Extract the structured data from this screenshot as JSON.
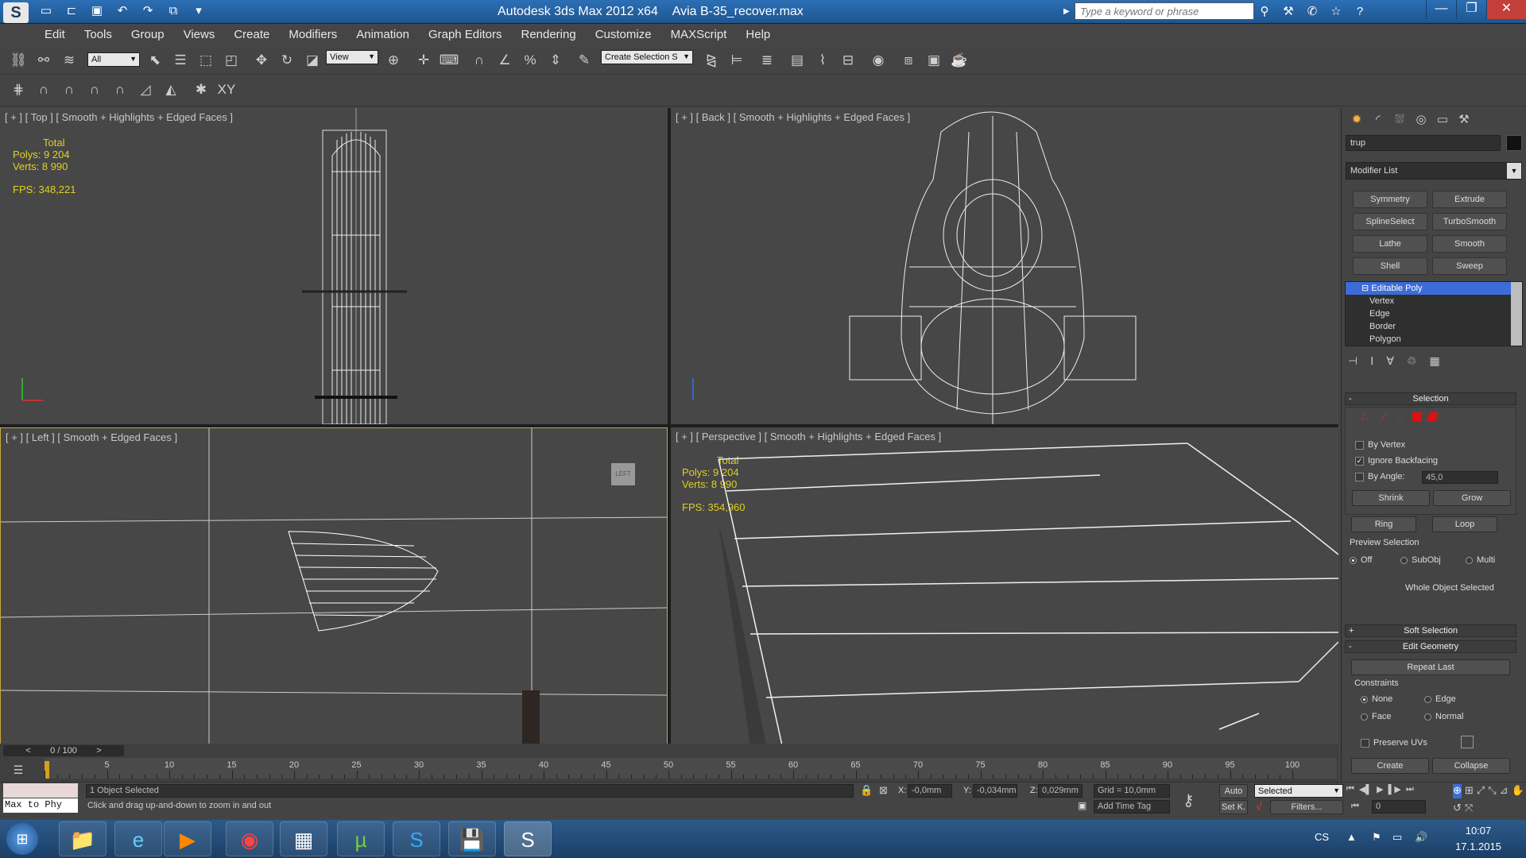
{
  "titlebar": {
    "app": "Autodesk 3ds Max  2012 x64",
    "file": "Avia B-35_recover.max",
    "search_placeholder": "Type a keyword or phrase",
    "logo": "S"
  },
  "menu": [
    "Edit",
    "Tools",
    "Group",
    "Views",
    "Create",
    "Modifiers",
    "Animation",
    "Graph Editors",
    "Rendering",
    "Customize",
    "MAXScript",
    "Help"
  ],
  "toolbar": {
    "filter_value": "All",
    "refcoord_value": "View",
    "selset_value": "Create Selection S"
  },
  "viewports": {
    "top": {
      "label": "[ + ] [ Top ] [ Smooth + Highlights + Edged Faces ]",
      "stats_total": "Total",
      "polys": "Polys: 9 204",
      "verts": "Verts: 8 990",
      "fps": "FPS:   348,221"
    },
    "back": {
      "label": "[ + ] [ Back ] [ Smooth + Highlights + Edged Faces ]"
    },
    "left": {
      "label": "[ + ] [ Left ] [ Smooth + Edged Faces ]",
      "viewcube": "LEFT"
    },
    "persp": {
      "label": "[ + ] [ Perspective ] [ Smooth + Highlights + Edged Faces ]",
      "stats_total": "Total",
      "polys": "Polys: 9 204",
      "verts": "Verts: 8 990",
      "fps": "FPS:   354,960"
    }
  },
  "command_panel": {
    "object_name": "trup",
    "object_color": "#111111",
    "modifier_list": "Modifier List",
    "modifier_buttons": [
      "Symmetry",
      "Extrude",
      "SplineSelect",
      "TurboSmooth",
      "Lathe",
      "Smooth",
      "Shell",
      "Sweep"
    ],
    "stack": [
      "Editable Poly",
      "Vertex",
      "Edge",
      "Border",
      "Polygon"
    ],
    "selection": {
      "title": "Selection",
      "by_vertex": "By Vertex",
      "ignore_backfacing": "Ignore Backfacing",
      "by_angle": "By Angle:",
      "angle_value": "45,0",
      "shrink": "Shrink",
      "grow": "Grow",
      "ring": "Ring",
      "loop": "Loop",
      "preview_title": "Preview Selection",
      "off": "Off",
      "subobj": "SubObj",
      "multi": "Multi",
      "status": "Whole Object Selected"
    },
    "soft_selection": "Soft Selection",
    "edit_geometry": {
      "title": "Edit Geometry",
      "repeat_last": "Repeat Last",
      "constraints": "Constraints",
      "none": "None",
      "edge": "Edge",
      "face": "Face",
      "normal": "Normal",
      "preserve_uvs": "Preserve UVs",
      "create": "Create",
      "collapse": "Collapse"
    }
  },
  "timeline": {
    "frame_display": "0 / 100",
    "tick_labels": [
      "5",
      "10",
      "15",
      "20",
      "25",
      "30",
      "35",
      "40",
      "45",
      "50",
      "55",
      "60",
      "65",
      "70",
      "75",
      "80",
      "85",
      "90",
      "95",
      "100"
    ]
  },
  "status": {
    "maxscript": "Max to Phy",
    "objects_selected": "1 Object Selected",
    "prompt": "Click and drag up-and-down to zoom in and out",
    "x_label": "X:",
    "x": "-0,0mm",
    "y_label": "Y:",
    "y": "-0,034mm",
    "z_label": "Z:",
    "z": "0,029mm",
    "grid": "Grid = 10,0mm",
    "add_time_tag": "Add Time Tag",
    "auto_key": "Auto",
    "set_key": "Set K.",
    "selected": "Selected",
    "filters": "Filters...",
    "frame": "0"
  },
  "taskbar": {
    "lang": "CS",
    "time": "10:07",
    "date": "17.1.2015"
  }
}
